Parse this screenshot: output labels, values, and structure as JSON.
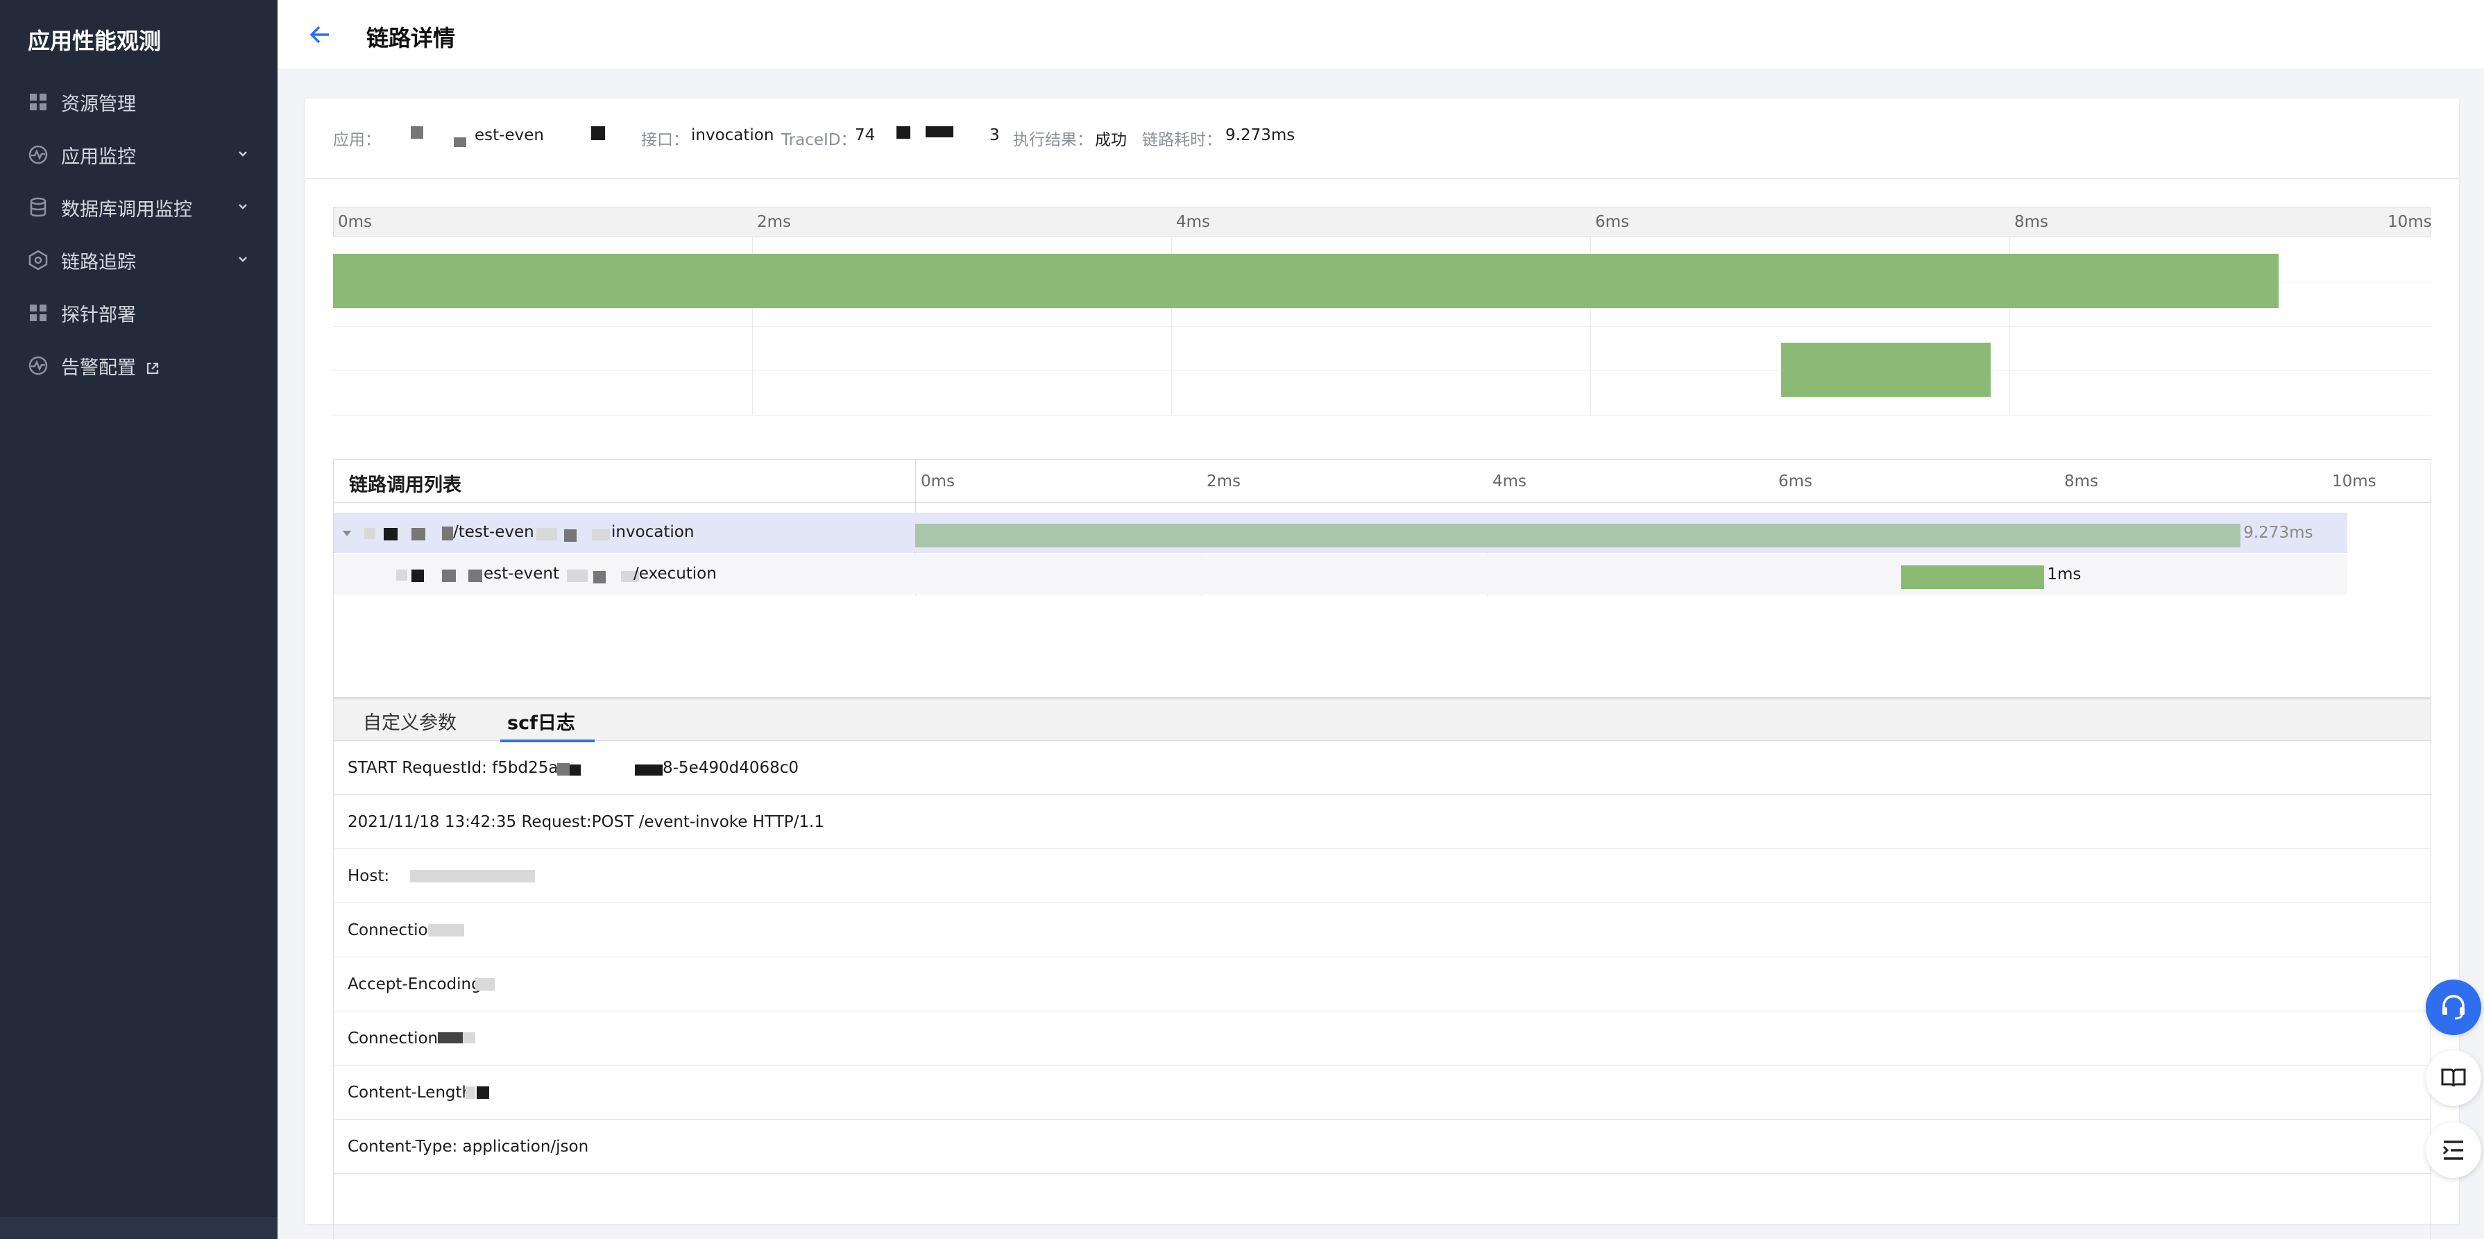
{
  "sidebar": {
    "title": "应用性能观测",
    "items": [
      {
        "label": "资源管理",
        "icon": "grid-icon",
        "expandable": false
      },
      {
        "label": "应用监控",
        "icon": "pulse-icon",
        "expandable": true
      },
      {
        "label": "数据库调用监控",
        "icon": "database-icon",
        "expandable": true
      },
      {
        "label": "链路追踪",
        "icon": "trace-icon",
        "expandable": true
      },
      {
        "label": "探针部署",
        "icon": "grid-icon",
        "expandable": false
      },
      {
        "label": "告警配置",
        "icon": "pulse-icon",
        "expandable": false,
        "external": true
      }
    ]
  },
  "header": {
    "title": "链路详情"
  },
  "info": {
    "app_label": "应用：",
    "app_value": "est-even",
    "api_label": "接口：",
    "api_value": "invocation",
    "traceid_label": "TraceID：",
    "traceid_value": "74",
    "traceid_suffix": "3",
    "result_label": "执行结果：",
    "result_value": "成功",
    "duration_label": "链路耗时：",
    "duration_value": "9.273ms"
  },
  "overview": {
    "ticks": [
      "0ms",
      "2ms",
      "4ms",
      "6ms",
      "8ms",
      "10ms"
    ],
    "max_ms": 10,
    "spans": [
      {
        "start_ms": 0,
        "duration_ms": 9.273
      },
      {
        "start_ms": 6.9,
        "duration_ms": 1.0
      }
    ]
  },
  "trace_list": {
    "title": "链路调用列表",
    "ticks": [
      "0ms",
      "2ms",
      "4ms",
      "6ms",
      "8ms",
      "10ms"
    ],
    "rows": [
      {
        "name_prefix": "/test-even",
        "name_suffix": "invocation",
        "start_ms": 0,
        "duration_ms": 9.273,
        "duration_label": "9.273ms",
        "selected": true
      },
      {
        "name_prefix": "est-event",
        "name_suffix": "/execution",
        "start_ms": 6.9,
        "duration_ms": 1.0,
        "duration_label": "1ms",
        "selected": false
      }
    ]
  },
  "tabs": [
    {
      "label": "自定义参数",
      "active": false
    },
    {
      "label": "scf日志",
      "active": true
    }
  ],
  "logs": [
    "START RequestId: f5bd25a",
    "8-5e490d4068c0",
    "2021/11/18 13:42:35 Request:POST /event-invoke HTTP/1.1",
    "Host:",
    "Connection.",
    "Accept-Encoding.",
    "Connection",
    "Content-Length",
    "Content-Type: application/json"
  ],
  "colors": {
    "sidebar_bg": "#232b3b",
    "bar_green": "#8aba74",
    "bar_selected": "#a9c6ac",
    "accent": "#2f6fef"
  }
}
